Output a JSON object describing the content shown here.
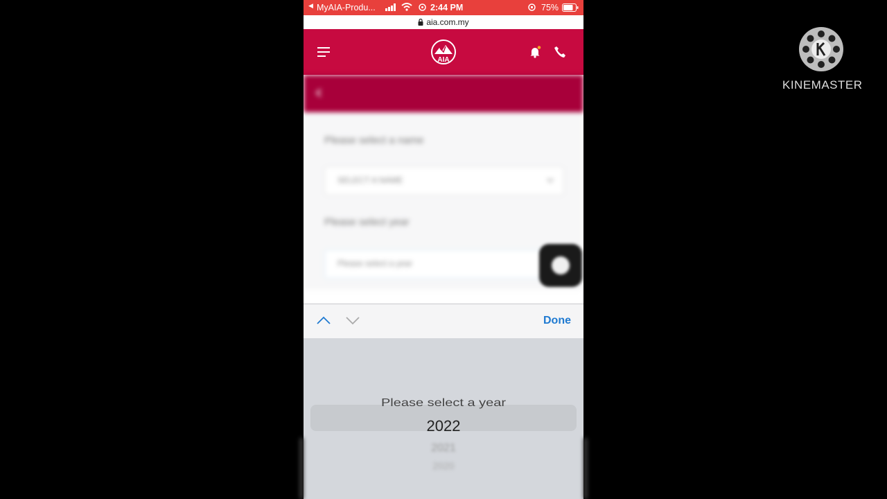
{
  "status_bar": {
    "carrier": "MyAIA-Produ...",
    "time": "2:44 PM",
    "battery": "75%"
  },
  "browser": {
    "url": "aia.com.my"
  },
  "app_header": {
    "logo_text": "AIA"
  },
  "page": {
    "select_name_label": "Please select a name",
    "select_name_value": "SELECT A NAME",
    "select_year_label": "Please select year",
    "select_year_placeholder": "Please select a year"
  },
  "keyboard_toolbar": {
    "done_label": "Done"
  },
  "picker": {
    "options": [
      "Please select a year",
      "2022",
      "2021",
      "2020"
    ],
    "selected": "2022"
  },
  "watermark": {
    "text": "KINEMASTER"
  },
  "colors": {
    "status_bar": "#e8403c",
    "header": "#c70a40",
    "accent_link": "#1f7ad1"
  }
}
